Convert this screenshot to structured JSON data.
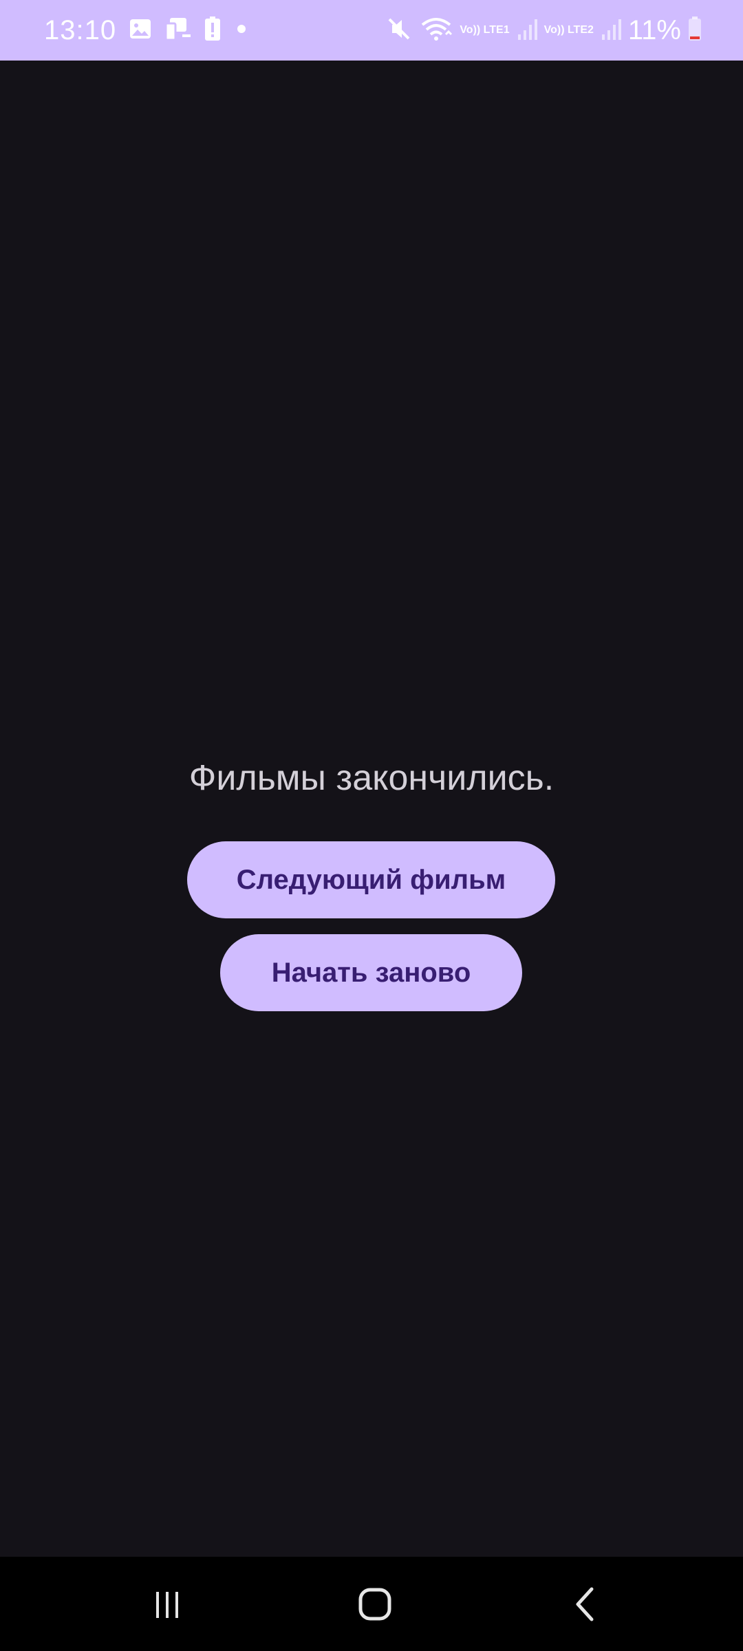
{
  "status_bar": {
    "time": "13:10",
    "sim1": "Vo)) LTE1",
    "sim2": "Vo)) LTE2",
    "battery": "11%",
    "background_color": "#d0bcff",
    "left_icons": [
      "gallery-icon",
      "devices-icon",
      "battery-alert-icon",
      "dot-icon"
    ],
    "right_icons": [
      "mute-icon",
      "wifi-icon",
      "signal-icon",
      "signal-icon",
      "battery-icon"
    ]
  },
  "main": {
    "message": "Фильмы закончились.",
    "next_button": "Следующий фильм",
    "restart_button": "Начать заново",
    "background_color": "#141218",
    "button_color": "#d0bcff",
    "button_text_color": "#381e72"
  },
  "nav_bar": {
    "icons": [
      "recent-apps-icon",
      "home-icon",
      "back-icon"
    ]
  }
}
